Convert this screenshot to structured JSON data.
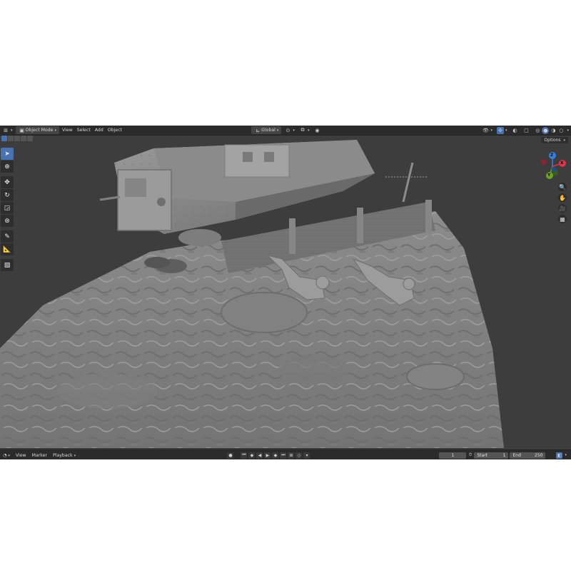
{
  "header": {
    "editor_type_icon": "3d-viewport-icon",
    "mode_label": "Object Mode",
    "menu": [
      "View",
      "Select",
      "Add",
      "Object"
    ],
    "transform_orientation": "Global",
    "options_label": "Options"
  },
  "toolbar": {
    "tools": [
      "select-box-icon",
      "cursor-icon",
      "move-icon",
      "rotate-icon",
      "scale-icon",
      "transform-icon",
      "annotate-icon",
      "measure-icon",
      "add-cube-icon"
    ],
    "active_tool": "select-box-icon"
  },
  "gizmo": {
    "axes": [
      {
        "label": "Z",
        "color": "#2f83e3"
      },
      {
        "label": "X",
        "color": "#e3344a"
      },
      {
        "label": "Y",
        "color": "#6ba424"
      }
    ]
  },
  "nav_buttons": [
    "zoom-icon",
    "hand-pan-icon",
    "camera-icon",
    "grid-ortho-icon"
  ],
  "timeline": {
    "menu": [
      "View",
      "Marker",
      "Playback"
    ],
    "current_frame": "1",
    "start_label": "Start",
    "start_value": "1",
    "end_label": "End",
    "end_value": "250"
  },
  "colors": {
    "accent": "#4772b3",
    "header_bg": "#2b2b2b",
    "viewport_bg": "#3d3d3d",
    "mesh": "#8e8e8e"
  }
}
